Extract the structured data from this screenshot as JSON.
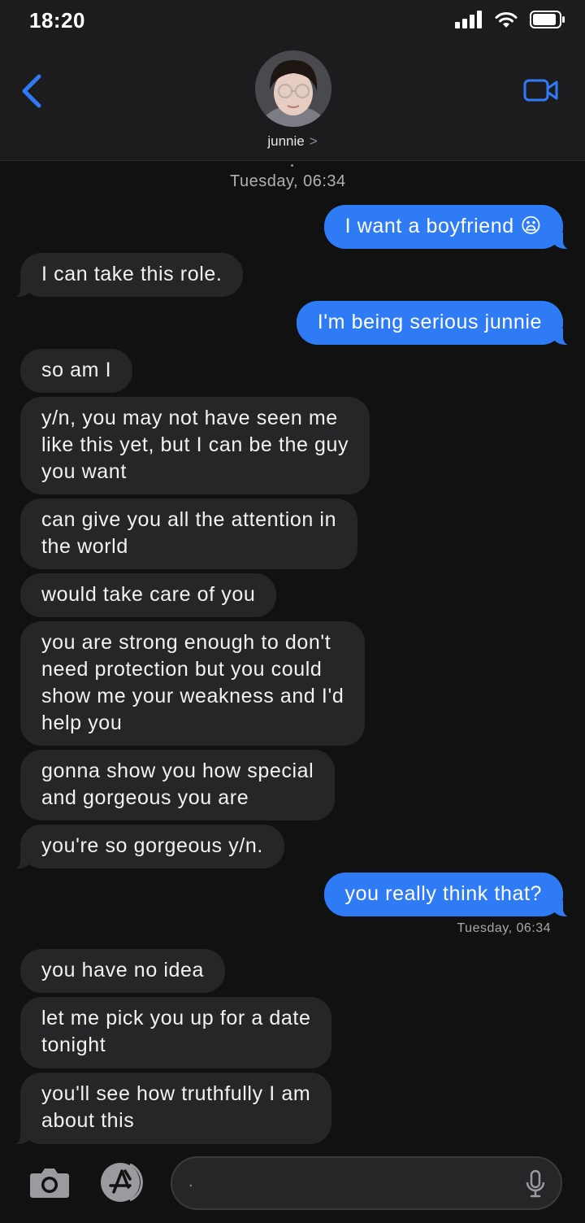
{
  "status": {
    "time": "18:20"
  },
  "header": {
    "contact_name": "junnie",
    "chevron": ">"
  },
  "timestamps": {
    "top": "Tuesday, 06:34",
    "after_question": "Tuesday, 06:34"
  },
  "messages": [
    {
      "dir": "out",
      "text": "I want a boyfriend 😦"
    },
    {
      "dir": "in",
      "text": "I can take this role."
    },
    {
      "dir": "out",
      "text": "I'm being serious junnie"
    },
    {
      "dir": "in",
      "text": "so am I"
    },
    {
      "dir": "in",
      "lines": [
        "y/n, you may not have seen me",
        "like this yet, but I can be the guy",
        "you want"
      ]
    },
    {
      "dir": "in",
      "lines": [
        "can give you all the attention in",
        "the world"
      ]
    },
    {
      "dir": "in",
      "text": "would take care of you"
    },
    {
      "dir": "in",
      "lines": [
        "you are strong enough to don't",
        "need protection but you could",
        "show me your weakness and I'd",
        "help you"
      ]
    },
    {
      "dir": "in",
      "lines": [
        "gonna show you how special",
        "and gorgeous you are"
      ]
    },
    {
      "dir": "in",
      "text": "you're so gorgeous y/n."
    },
    {
      "dir": "out",
      "text": "you really think that?"
    },
    {
      "dir": "in",
      "text": "you have no idea"
    },
    {
      "dir": "in",
      "lines": [
        "let me pick you up for a date",
        "tonight"
      ]
    },
    {
      "dir": "in",
      "lines": [
        "you'll see how truthfully I am",
        "about this"
      ]
    }
  ],
  "input": {
    "text": "."
  },
  "icons": [
    "back-chevron-icon",
    "video-call-icon",
    "camera-icon",
    "app-store-icon",
    "microphone-icon",
    "signal-icon",
    "wifi-icon",
    "battery-icon"
  ],
  "colors": {
    "outgoing": "#2f7bf6",
    "incoming": "#262628",
    "accent": "#2f7bf6"
  }
}
